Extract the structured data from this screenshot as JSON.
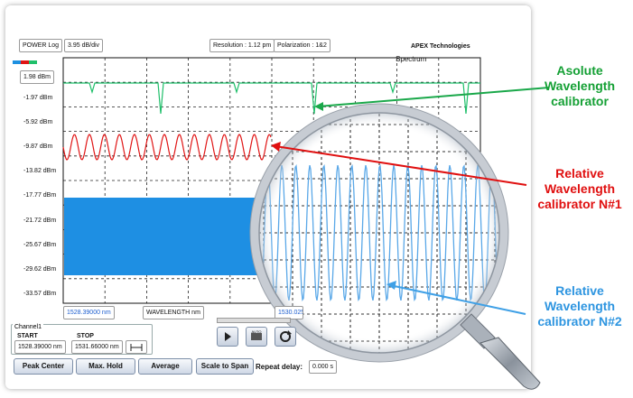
{
  "header": {
    "power_mode": "POWER Log",
    "scale": "3.95 dB/div",
    "resolution": "Resolution : 1.12 pm",
    "polarization": "Polarization : 1&2",
    "brand": "APEX Technologies",
    "graph_title": "Spectrum"
  },
  "ref_level": "1.98 dBm",
  "y_ticks": [
    "-1.97 dBm",
    "-5.92 dBm",
    "-9.87 dBm",
    "-13.82 dBm",
    "-17.77 dBm",
    "-21.72 dBm",
    "-25.67 dBm",
    "-29.62 dBm",
    "-33.57 dBm"
  ],
  "x_axis": {
    "start": "1528.39000 nm",
    "label": "WAVELENGTH nm",
    "center": "1530.025"
  },
  "channel": {
    "tab": "Channel1",
    "start_label": "START",
    "stop_label": "STOP",
    "start_value": "1528.39000 nm",
    "stop_value": "1531.66000 nm"
  },
  "buttons": {
    "peak_center": "Peak Center",
    "max_hold": "Max. Hold",
    "average": "Average",
    "scale_to_span": "Scale to Span"
  },
  "repeat": {
    "label": "Repeat delay:",
    "value": "0.000 s"
  },
  "annotations": {
    "absolute": [
      "Asolute",
      "Wavelength",
      "calibrator"
    ],
    "relative1": [
      "Relative",
      "Wavelength",
      "calibrator N#1"
    ],
    "relative2": [
      "Relative",
      "Wavelength",
      "calibrator N#2"
    ]
  },
  "colors": {
    "absolute": "#1fbf6a",
    "relative1": "#e01515",
    "relative2": "#1e90e0",
    "anno_green": "#15a035",
    "anno_red": "#e01010",
    "anno_blue": "#2e95e0"
  }
}
